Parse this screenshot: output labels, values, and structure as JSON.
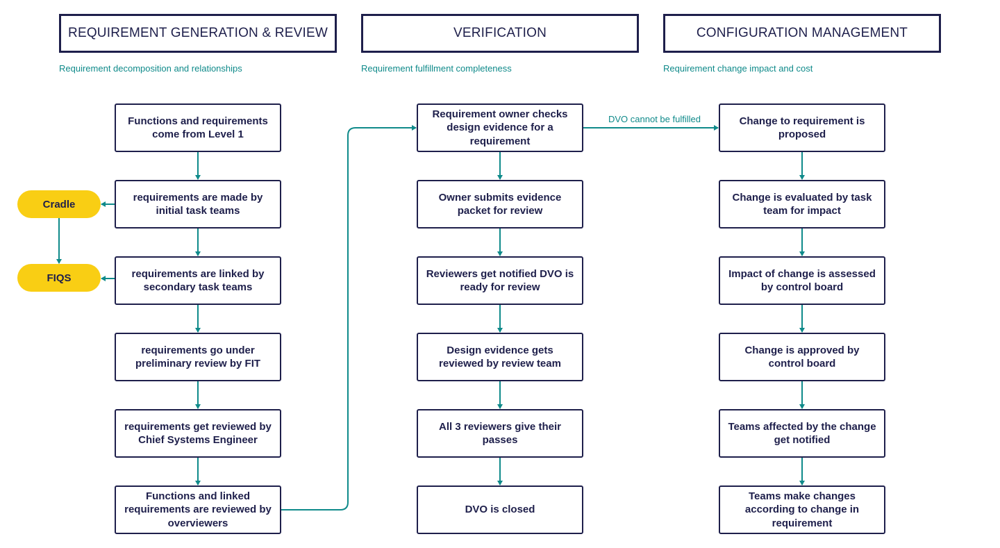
{
  "columns": [
    {
      "title": "REQUIREMENT GENERATION & REVIEW",
      "subtitle": "Requirement decomposition and relationships",
      "steps": [
        "Functions and requirements come from Level 1",
        "requirements are made by initial task teams",
        "requirements are linked by secondary task teams",
        "requirements go under preliminary review by FIT",
        "requirements get reviewed by Chief Systems Engineer",
        "Functions and linked requirements are reviewed by overviewers"
      ]
    },
    {
      "title": "VERIFICATION",
      "subtitle": "Requirement fulfillment completeness",
      "steps": [
        "Requirement owner checks design evidence for a requirement",
        "Owner submits evidence packet for review",
        "Reviewers get notified DVO is ready for review",
        "Design evidence gets reviewed by review team",
        "All 3 reviewers give their passes",
        "DVO is closed"
      ]
    },
    {
      "title": "CONFIGURATION MANAGEMENT",
      "subtitle": "Requirement change impact and cost",
      "steps": [
        "Change to requirement is proposed",
        "Change is evaluated by task team for impact",
        "Impact of change is assessed by control board",
        "Change is approved by control board",
        "Teams affected by the change get notified",
        "Teams make changes according to change in requirement"
      ]
    }
  ],
  "tools": [
    {
      "label": "Cradle"
    },
    {
      "label": "FIQS"
    }
  ],
  "edge_labels": {
    "dvo_not_fulfilled": "DVO cannot be fulfilled"
  },
  "colors": {
    "box_border": "#1e1f4b",
    "connector": "#0f8a8a",
    "tool_pill": "#f9ce14",
    "subtitle": "#0f8a8a"
  }
}
